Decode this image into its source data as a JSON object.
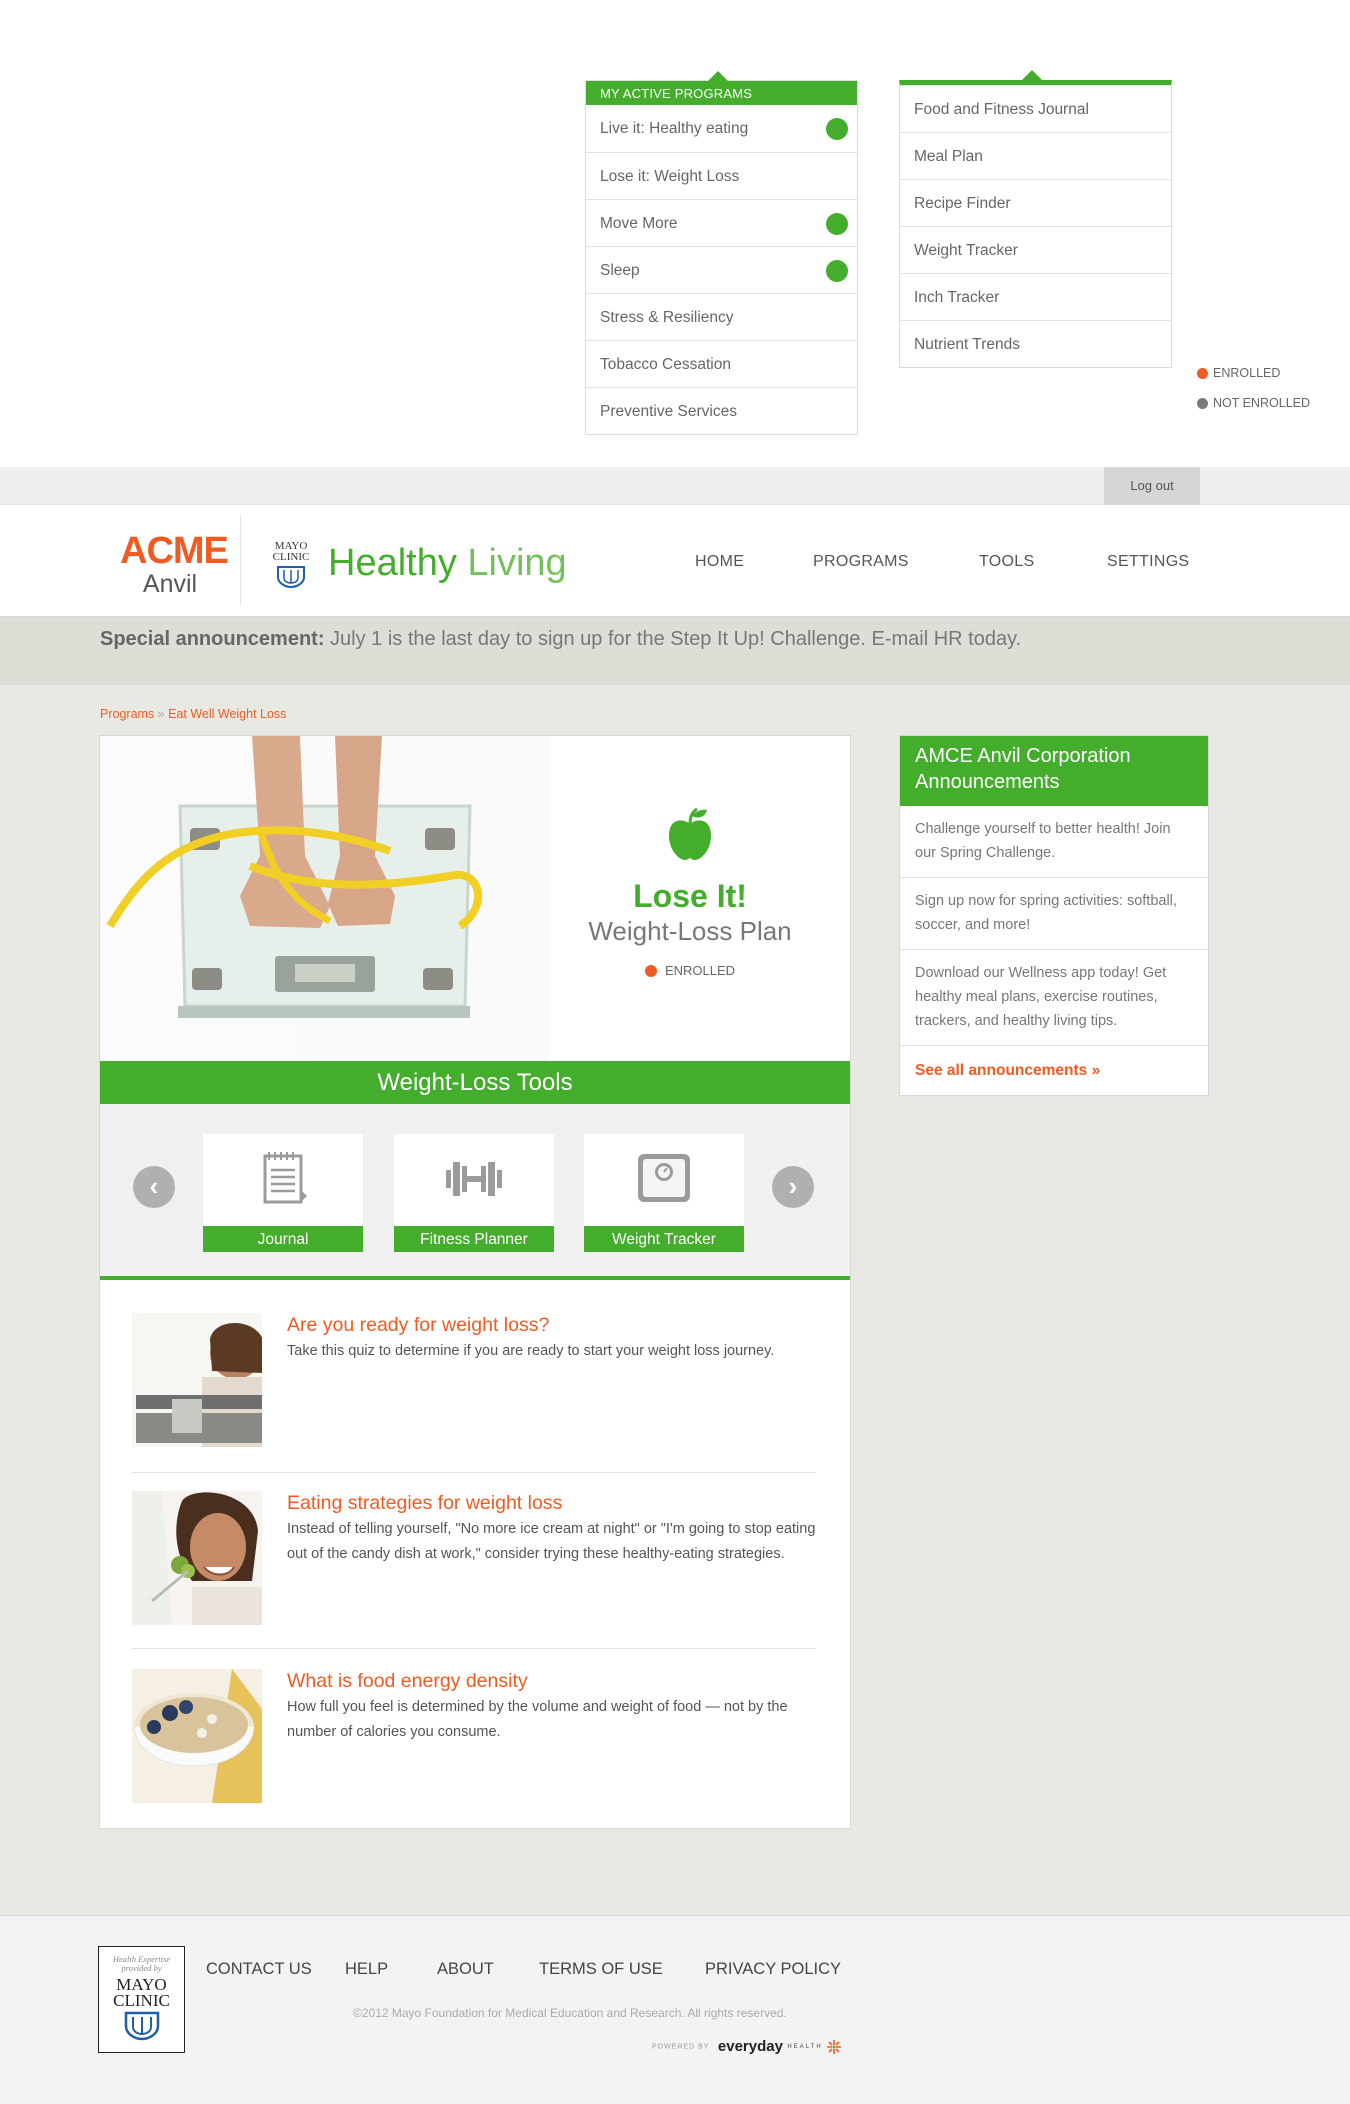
{
  "colors": {
    "green": "#44ad2c",
    "orange": "#f15a22",
    "enrolled": "#f15a22",
    "not_enrolled": "#7a7a7a",
    "content_bg": "#e9e9e3"
  },
  "programs_menu": {
    "header": "MY ACTIVE  PROGRAMS",
    "items": [
      {
        "label": "Live it: Healthy eating",
        "active": true
      },
      {
        "label": "Lose it: Weight Loss",
        "active": false
      },
      {
        "label": "Move More",
        "active": true
      },
      {
        "label": "Sleep",
        "active": true
      },
      {
        "label": "Stress & Resiliency",
        "active": false
      },
      {
        "label": "Tobacco Cessation",
        "active": false
      },
      {
        "label": "Preventive Services",
        "active": false
      }
    ]
  },
  "tools_menu": {
    "items": [
      "Food and Fitness Journal",
      "Meal Plan",
      "Recipe Finder",
      "Weight Tracker",
      "Inch Tracker",
      "Nutrient Trends"
    ]
  },
  "legend": {
    "enrolled": "ENROLLED",
    "not_enrolled": "NOT ENROLLED"
  },
  "topbar": {
    "logout": "Log out"
  },
  "header": {
    "acme": "ACME",
    "anvil": "Anvil",
    "mayo_line1": "MAYO",
    "mayo_line2": "CLINIC",
    "brand_strong": "Healthy",
    "brand_light": " Living",
    "nav": [
      "HOME",
      "PROGRAMS",
      "TOOLS",
      "SETTINGS"
    ]
  },
  "announcement": {
    "label": "Special announcement:",
    "text": " July 1 is the last day to sign up for the Step It Up! Challenge. E-mail HR today."
  },
  "breadcrumb": {
    "parent": "Programs",
    "sep": " » ",
    "current": "Eat Well Weight Loss"
  },
  "hero": {
    "title": "Lose It!",
    "subtitle": "Weight-Loss Plan",
    "status": "ENROLLED",
    "icon": "apple-icon"
  },
  "tools_section": {
    "title": "Weight-Loss Tools",
    "prev_icon": "‹",
    "next_icon": "›",
    "tiles": [
      {
        "label": "Journal",
        "icon": "notepad-icon"
      },
      {
        "label": "Fitness Planner",
        "icon": "dumbbell-icon"
      },
      {
        "label": "Weight Tracker",
        "icon": "scale-icon"
      }
    ]
  },
  "articles": [
    {
      "title": "Are you ready for weight loss?",
      "text": "Take this quiz to determine if you are ready to start your weight loss journey."
    },
    {
      "title": "Eating strategies for weight loss",
      "text": "Instead of telling yourself, \"No more ice cream at night\" or \"I'm going to stop eating out of the candy dish at work,\" consider trying these healthy-eating strategies."
    },
    {
      "title": "What is food energy density",
      "text": "How full you feel is determined by the volume and weight of food — not by the number of calories you consume."
    }
  ],
  "sidebar": {
    "title": "AMCE Anvil Corporation Announcements",
    "items": [
      "Challenge yourself to better health! Join our Spring Challenge.",
      "Sign up now for spring activities: softball, soccer, and more!",
      "Download our Wellness app today! Get healthy meal plans, exercise routines, trackers, and healthy living tips."
    ],
    "more": "See all announcements »"
  },
  "footer": {
    "badge_caption_1": "Health Expertise",
    "badge_caption_2": "provided by",
    "badge_word_1": "MAYO",
    "badge_word_2": "CLINIC",
    "links": [
      "CONTACT US",
      "HELP",
      "ABOUT",
      "TERMS OF USE",
      "PRIVACY POLICY"
    ],
    "copyright": "©2012 Mayo Foundation for Medical Education and Research. All rights reserved.",
    "powered_by": "POWERED BY",
    "everyday": "everyday",
    "health": "HEALTH"
  }
}
